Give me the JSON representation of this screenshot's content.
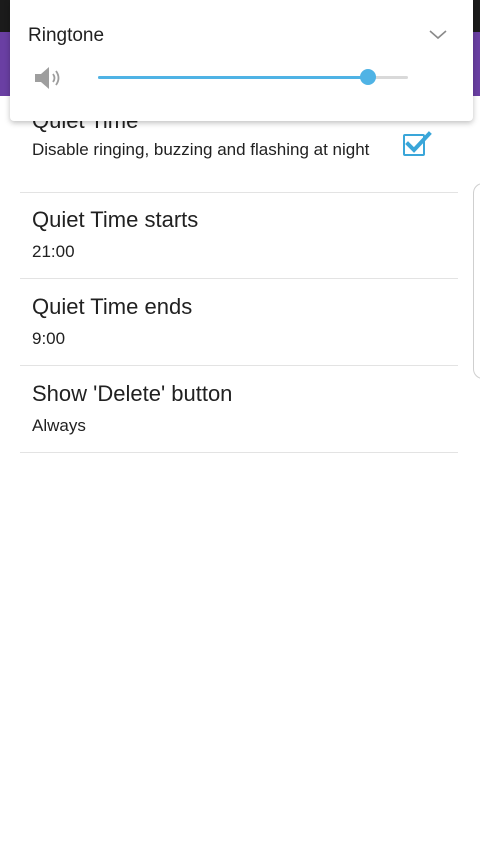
{
  "volume_panel": {
    "title": "Ringtone",
    "level": 0.87,
    "accent_color": "#4fb3e5",
    "icons": {
      "speaker": "speaker-volume-icon",
      "expand": "chevron-down-icon"
    }
  },
  "settings": {
    "quiet_time": {
      "title": "Quiet Time",
      "summary": "Disable ringing, buzzing and flashing at night",
      "checked": true
    },
    "quiet_time_starts": {
      "title": "Quiet Time starts",
      "value": "21:00"
    },
    "quiet_time_ends": {
      "title": "Quiet Time ends",
      "value": "9:00"
    },
    "show_delete_button": {
      "title": "Show 'Delete' button",
      "value": "Always"
    }
  },
  "colors": {
    "app_bar": "#6a3fa3",
    "status_bar": "#1b1b1b",
    "checkbox": "#3aa6d9"
  }
}
